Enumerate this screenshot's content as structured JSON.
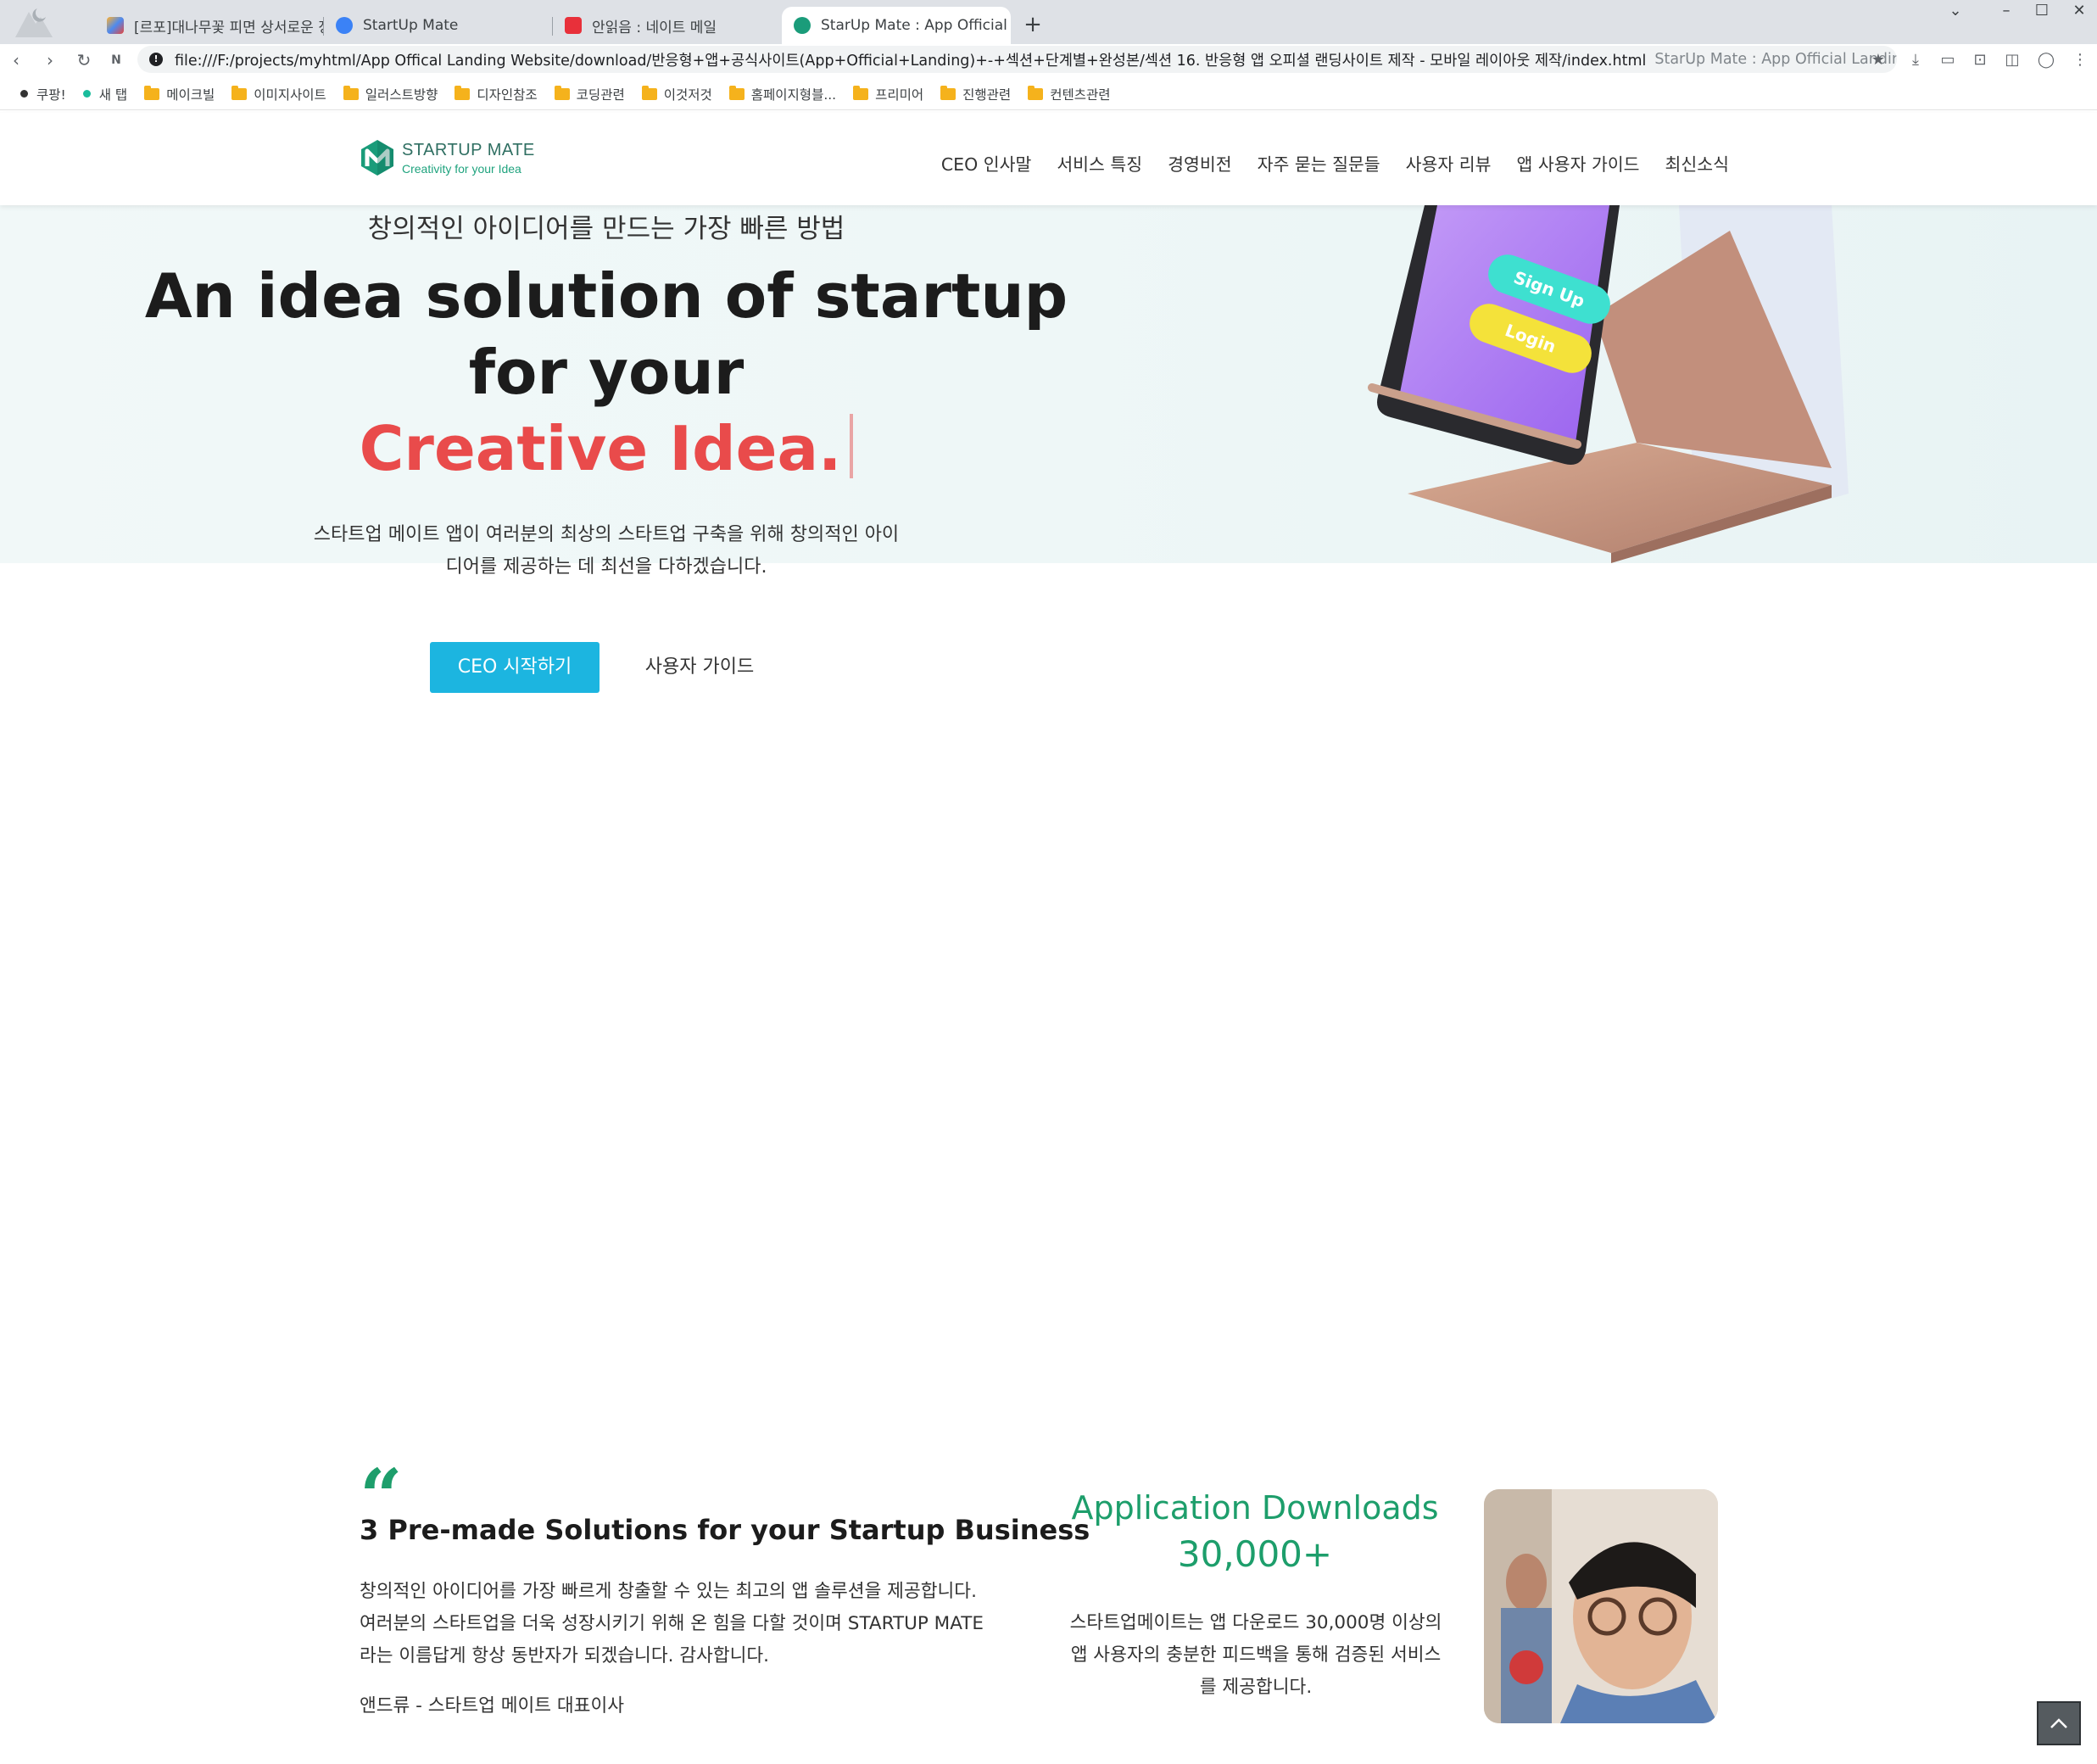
{
  "browser": {
    "tabs": [
      {
        "title": "[르포]대나무꽃 피면 상서로운 징",
        "active": false
      },
      {
        "title": "StartUp Mate",
        "active": false
      },
      {
        "title": "안읽음 : 네이트 메일",
        "active": false
      },
      {
        "title": "StarUp Mate : App Official Landi",
        "active": true
      }
    ],
    "new_tab": "+",
    "url": "file:///F:/projects/myhtml/App Offical Landing Website/download/반응형+앱+공식사이트(App+Official+Landing)+-+섹션+단계별+완성본/섹션 16. 반응형 앱 오피셜 랜딩사이트 제작 - 모바일 레이아웃 제작/index.html",
    "page_title_hint": "StarUp Mate : App Official Landing",
    "bookmarks": [
      {
        "label": "쿠팡!",
        "type": "dot",
        "color": "#333333"
      },
      {
        "label": "새 탭",
        "type": "dot",
        "color": "#1abc9c"
      },
      {
        "label": "메이크빌",
        "type": "folder"
      },
      {
        "label": "이미지사이트",
        "type": "folder"
      },
      {
        "label": "일러스트방향",
        "type": "folder"
      },
      {
        "label": "디자인참조",
        "type": "folder"
      },
      {
        "label": "코딩관련",
        "type": "folder"
      },
      {
        "label": "이것저것",
        "type": "folder"
      },
      {
        "label": "홈페이지형블...",
        "type": "folder"
      },
      {
        "label": "프리미어",
        "type": "folder"
      },
      {
        "label": "진행관련",
        "type": "folder"
      },
      {
        "label": "컨텐츠관련",
        "type": "folder"
      }
    ]
  },
  "site": {
    "logo": {
      "name": "STARTUP MATE",
      "tagline": "Creativity for your Idea"
    },
    "menu": [
      "CEO 인사말",
      "서비스 특징",
      "경영비전",
      "자주 묻는 질문들",
      "사용자 리뷰",
      "앱 사용자 가이드",
      "최신소식"
    ]
  },
  "hero": {
    "subtitle": "창의적인 아이디어를 만드는 가장 빠른 방법",
    "title_line1": "An idea solution of startup",
    "title_line2": "for your",
    "title_highlight": "Creative Idea.",
    "description": "스타트업 메이트 앱이 여러분의 최상의 스타트업 구축을 위해 창의적인 아이디어를 제공하는 데 최선을 다하겠습니다.",
    "primary_button": "CEO 시작하기",
    "secondary_button": "사용자 가이드",
    "phone_buttons": {
      "signup": "Sign Up",
      "login": "Login"
    }
  },
  "ceo_section": {
    "quote_mark": "“",
    "title": "3 Pre-made Solutions for your Startup Business",
    "description": "창의적인 아이디어를 가장 빠르게 창출할 수 있는 최고의 앱 솔루션을 제공합니다. 여러분의 스타트업을 더욱 성장시키기 위해 온 힘을 다할 것이며 STARTUP MATE 라는 이름답게 항상 동반자가 되겠습니다. 감사합니다.",
    "signature": "앤드류 - 스타트업 메이트 대표이사",
    "downloads_label": "Application Downloads",
    "downloads_value": "30,000+",
    "downloads_desc": "스타트업메이트는 앱 다운로드 30,000명 이상의 앱 사용자의 충분한 피드백을 통해 검증된 서비스를 제공합니다."
  },
  "colors": {
    "accent_green": "#1d9e6b",
    "cta_blue": "#1cb5e0",
    "highlight_red": "#e94b4b"
  }
}
